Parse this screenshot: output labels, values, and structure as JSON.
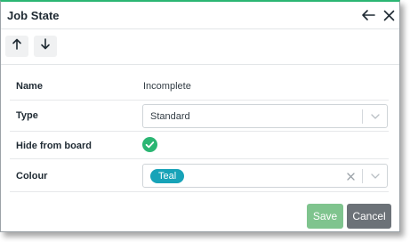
{
  "dialog": {
    "title": "Job State",
    "icons": {
      "back": "arrow-left-icon",
      "close": "close-icon"
    }
  },
  "toolbar": {
    "up_icon": "arrow-up-icon",
    "down_icon": "arrow-down-icon"
  },
  "fields": {
    "name": {
      "label": "Name",
      "value": "Incomplete"
    },
    "type": {
      "label": "Type",
      "value": "Standard"
    },
    "hide_from_board": {
      "label": "Hide from board",
      "checked": true,
      "icon": "check-circle-icon"
    },
    "colour": {
      "label": "Colour",
      "tag": "Teal",
      "tag_color": "#17a3b8"
    }
  },
  "buttons": {
    "save": "Save",
    "cancel": "Cancel"
  },
  "colors": {
    "accent_top": "#2bb673",
    "save_bg": "#7fc48e",
    "cancel_bg": "#6c7278",
    "check": "#2bb673"
  }
}
